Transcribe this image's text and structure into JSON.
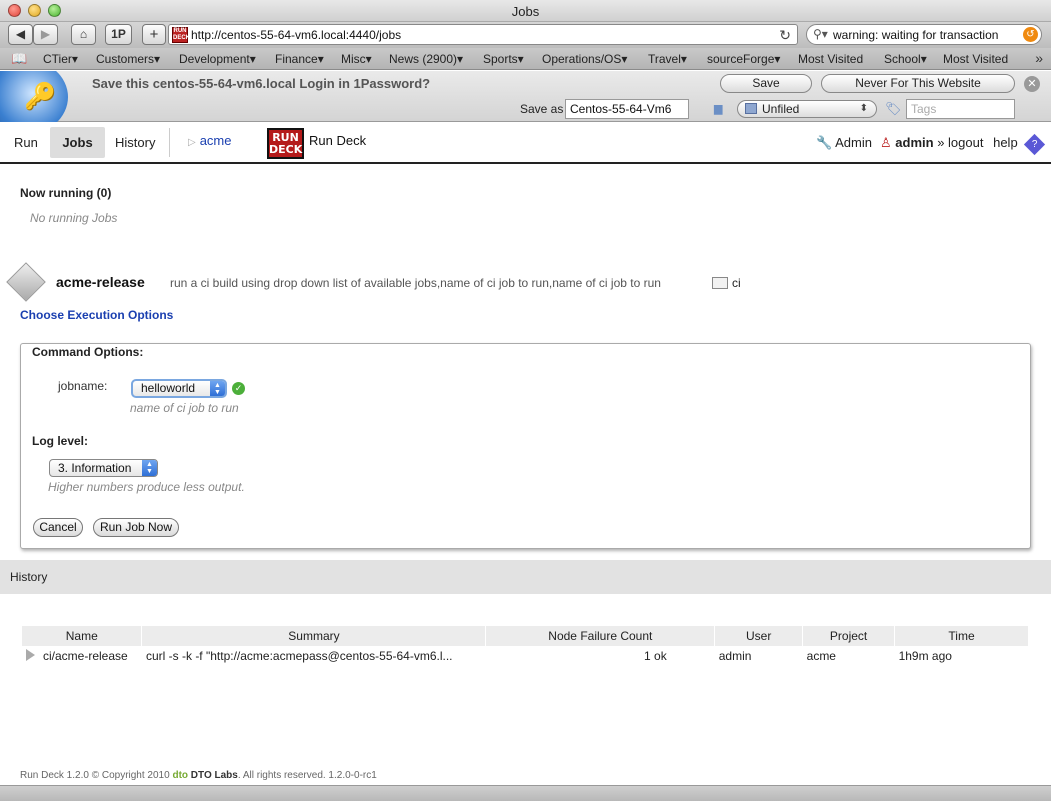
{
  "window": {
    "title": "Jobs"
  },
  "toolbar": {
    "url": "http://centos-55-64-vm6.local:4440/jobs",
    "search_text": "warning:  waiting for transaction",
    "onepassword_label": "1P",
    "add_label": "+"
  },
  "bookmarks": [
    "CTier▾",
    "Customers▾",
    "Development▾",
    "Finance▾",
    "Misc▾",
    "News (2900)▾",
    "Sports▾",
    "Operations/OS▾",
    "Travel▾",
    "sourceForge▾",
    "Most Visited",
    "School▾",
    "Most Visited"
  ],
  "onepassword": {
    "message": "Save this centos-55-64-vm6.local Login in 1Password?",
    "save_label": "Save",
    "never_label": "Never For This Website",
    "save_as_label": "Save as",
    "save_as_value": "Centos-55-64-Vm6",
    "folder": "Unfiled",
    "tags_placeholder": "Tags"
  },
  "nav": {
    "run": "Run",
    "jobs": "Jobs",
    "history": "History",
    "project": "acme",
    "logo_text": "RUN DECK",
    "app_title": "Run Deck",
    "admin": "Admin",
    "user": "admin",
    "logout": "» logout",
    "help": "help"
  },
  "now_running": {
    "title": "Now running (0)",
    "empty": "No running Jobs"
  },
  "job": {
    "name": "acme-release",
    "description": "run a ci build using drop down list of available jobs,name of ci job to run,name of ci job to run",
    "group": "ci",
    "choose_options": "Choose Execution Options"
  },
  "options": {
    "title": "Command Options:",
    "jobname_label": "jobname:",
    "jobname_value": "helloworld",
    "jobname_hint": "name of ci job to run",
    "loglevel_title": "Log level:",
    "loglevel_value": "3. Information",
    "loglevel_hint": "Higher numbers produce less output.",
    "cancel": "Cancel",
    "run_now": "Run Job Now"
  },
  "history": {
    "title": "History",
    "columns": [
      "Name",
      "Summary",
      "Node Failure Count",
      "User",
      "Project",
      "Time"
    ],
    "rows": [
      {
        "name": "ci/acme-release",
        "summary": "curl -s -k -f \"http://acme:acmepass@centos-55-64-vm6.l...",
        "node_failure": "1 ok",
        "user": "admin",
        "project": "acme",
        "time": "1h9m ago"
      }
    ]
  },
  "footer": {
    "prefix": "Run Deck 1.2.0 © Copyright 2010",
    "company": "DTO Labs",
    "suffix": ". All rights reserved. 1.2.0-0-rc1"
  }
}
